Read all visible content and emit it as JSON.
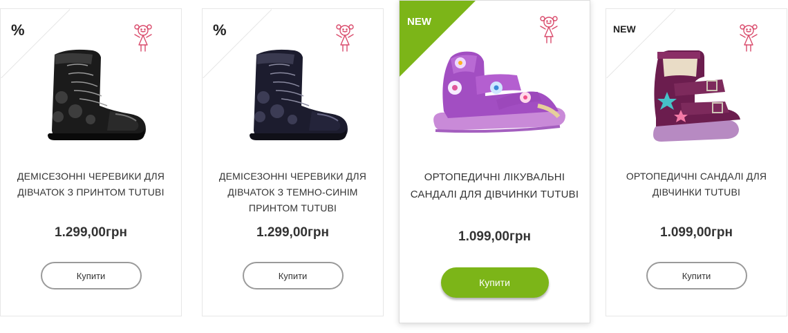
{
  "colors": {
    "accent": "#7cb518",
    "icon_pink": "#d94a6b"
  },
  "products": [
    {
      "badge": "%",
      "title_lines": [
        "ДЕМІСЕЗОННІ ЧЕРЕВИКИ ДЛЯ",
        "ДІВЧАТОК З ПРИНТОМ TUTUBI"
      ],
      "price": "1.299,00грн",
      "buy_label": "Купити",
      "icon": "girl-icon",
      "image": "black-ankle-boot"
    },
    {
      "badge": "%",
      "title_lines": [
        "ДЕМІСЕЗОННІ ЧЕРЕВИКИ ДЛЯ",
        "ДІВЧАТОК З ТЕМНО-СИНІМ",
        "ПРИНТОМ TUTUBI"
      ],
      "price": "1.299,00грн",
      "buy_label": "Купити",
      "icon": "girl-icon",
      "image": "navy-ankle-boot"
    },
    {
      "badge": "NEW",
      "title_lines": [
        "ОРТОПЕДИЧНІ ЛІКУВАЛЬНІ",
        "САНДАЛІ ДЛЯ ДІВЧИНКИ TUTUBI"
      ],
      "price": "1.099,00грн",
      "buy_label": "Купити",
      "icon": "girl-icon",
      "image": "lilac-orthopedic-sandal"
    },
    {
      "badge": "NEW",
      "title_lines": [
        "ОРТОПЕДИЧНІ САНДАЛІ ДЛЯ",
        "ДІВЧИНКИ TUTUBI"
      ],
      "price": "1.099,00грн",
      "buy_label": "Купити",
      "icon": "girl-icon",
      "image": "plum-orthopedic-sandal"
    }
  ]
}
